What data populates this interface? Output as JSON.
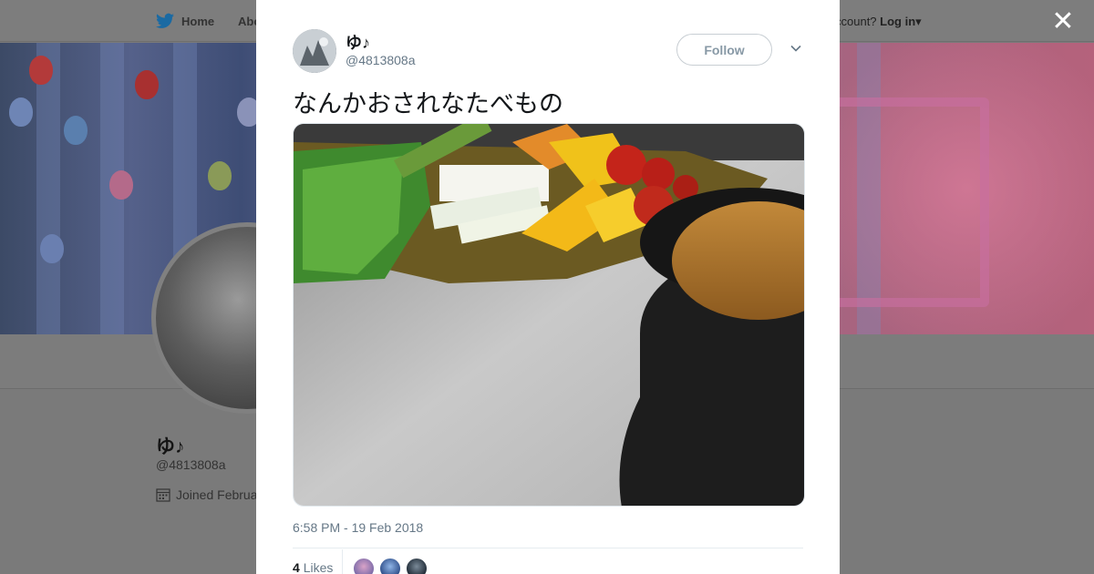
{
  "nav": {
    "home_label": "Home",
    "about_label": "Abo",
    "login_prefix": "ccount?",
    "login_label": "Log in"
  },
  "profile": {
    "name": "ゆ♪",
    "handle": "@4813808a",
    "joined": "Joined Februa"
  },
  "tweet": {
    "author_name": "ゆ♪",
    "author_handle": "@4813808a",
    "follow_label": "Follow",
    "text": "なんかおされなたべもの",
    "timestamp": "6:58 PM - 19 Feb 2018",
    "likes_count": "4",
    "likes_label": "Likes"
  },
  "colors": {
    "twitter_blue": "#1da1f2",
    "secondary_text": "#657786"
  },
  "icons": {
    "close": "close-icon",
    "twitter": "twitter-bird-icon",
    "calendar": "calendar-icon",
    "chevron": "chevron-down-icon"
  }
}
